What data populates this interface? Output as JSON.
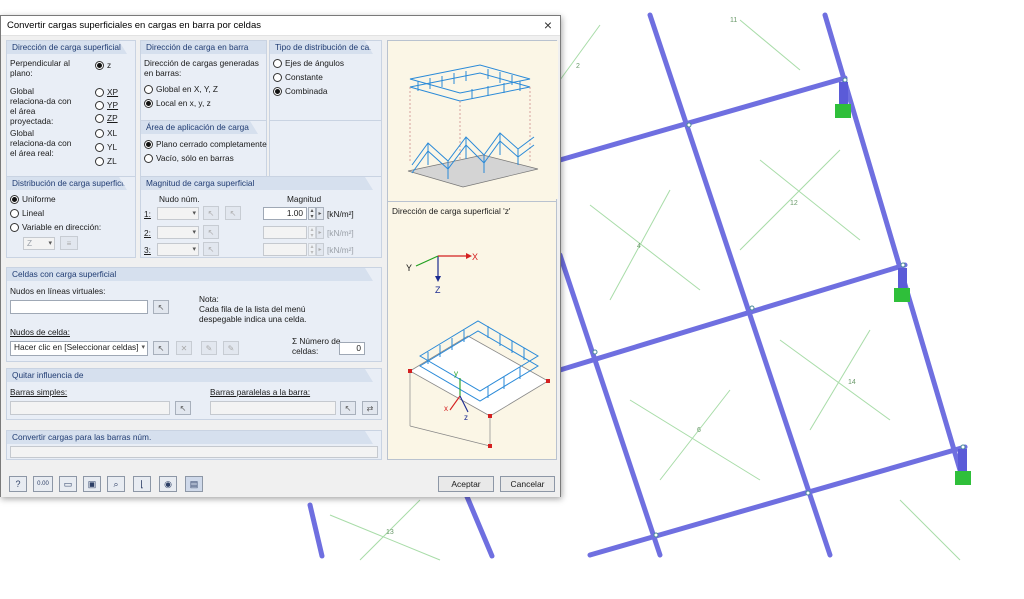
{
  "dialog": {
    "title": "Convertir cargas superficiales en cargas en barra por celdas",
    "close_glyph": "×"
  },
  "surface_load_direction": {
    "header": "Dirección de carga superficial",
    "perpendicular_label": "Perpendicular al plano:",
    "projected_label": "Global relaciona-da con el área proyectada:",
    "real_label": "Global relaciona-da con el área real:",
    "options": [
      "z",
      "XP",
      "YP",
      "ZP",
      "XL",
      "YL",
      "ZL"
    ],
    "selected": "z"
  },
  "member_load_direction": {
    "header": "Dirección de carga en barra",
    "sublabel": "Dirección de cargas generadas en barras:",
    "options": [
      "Global en X, Y, Z",
      "Local en x, y, z"
    ],
    "selected": "Local en x, y, z"
  },
  "distribution_type": {
    "header": "Tipo de distribución de carga",
    "options": [
      "Ejes de ángulos",
      "Constante",
      "Combinada"
    ],
    "selected": "Combinada"
  },
  "application_area": {
    "header": "Área de aplicación de carga",
    "options": [
      "Plano cerrado completamente",
      "Vacío, sólo en barras"
    ],
    "selected": "Plano cerrado completamente"
  },
  "surface_load_distribution": {
    "header": "Distribución de carga superficial",
    "options": [
      "Uniforme",
      "Lineal",
      "Variable en dirección:"
    ],
    "selected": "Uniforme",
    "direction_value": "Z"
  },
  "load_magnitude": {
    "header": "Magnitud de carga superficial",
    "col_node": "Nudo núm.",
    "col_magnitude": "Magnitud",
    "rows": [
      {
        "label": "1:",
        "value": "1.00",
        "unit": "[kN/m²]"
      },
      {
        "label": "2:",
        "value": "",
        "unit": "[kN/m²]"
      },
      {
        "label": "3:",
        "value": "",
        "unit": "[kN/m²]"
      }
    ]
  },
  "cells": {
    "header": "Celdas con carga superficial",
    "virtual_nodes_label": "Nudos en líneas virtuales:",
    "virtual_nodes_value": "",
    "note_title": "Nota:",
    "note_text": "Cada fila de la lista del menú despegable indica una celda.",
    "cell_nodes_label": "Nudos de celda:",
    "cell_nodes_value": "Hacer clic en [Seleccionar celdas]",
    "count_label": "Σ Número de celdas:",
    "count_value": "0"
  },
  "remove_influence": {
    "header": "Quitar influencia de",
    "simple_members_label": "Barras simples:",
    "parallel_members_label": "Barras paralelas a la barra:"
  },
  "convert_members": {
    "header": "Convertir cargas para las barras núm."
  },
  "preview": {
    "caption": "Dirección de carga superficial 'z'",
    "axis_y": "Y",
    "axis_x": "X",
    "axis_z": "Z",
    "local_y": "y",
    "local_x": "x",
    "local_z": "z"
  },
  "footer": {
    "ok": "Aceptar",
    "cancel": "Cancelar",
    "icons": [
      "help-icon",
      "units-icon",
      "open-icon",
      "save-icon",
      "zoom-icon",
      "axes-icon",
      "eye-icon",
      "display-icon"
    ],
    "units_text": "0.00"
  },
  "colors": {
    "member": "#6f6fe0",
    "support": "#2fbf3a",
    "grid_line": "#9ad49a",
    "load_arrows": "#2a8ad8",
    "group_header": "#d6e0ee"
  },
  "view_labels": [
    "11",
    "2",
    "12",
    "4",
    "14",
    "6",
    "13"
  ]
}
